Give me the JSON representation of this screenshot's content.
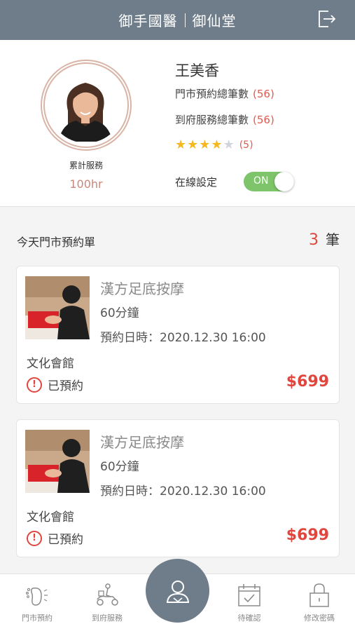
{
  "header": {
    "title_left": "御手國醫",
    "title_right": "御仙堂"
  },
  "profile": {
    "name": "王美香",
    "service_label": "累計服務",
    "service_hours": "100hr",
    "stats": [
      {
        "label": "門市預約總筆數",
        "value": "(56)"
      },
      {
        "label": "到府服務總筆數",
        "value": "(56)"
      }
    ],
    "rating": {
      "stars": 4,
      "max": 5,
      "count": "(5)"
    },
    "online_label": "在線設定",
    "online_toggle": "ON"
  },
  "section": {
    "title": "今天門市預約單",
    "count": "3",
    "count_unit": "筆"
  },
  "bookings": [
    {
      "service": "漢方足底按摩",
      "duration": "60分鐘",
      "time": "預約日時：2020.12.30 16:00",
      "venue": "文化會館",
      "status": "已預約",
      "price": "$699"
    },
    {
      "service": "漢方足底按摩",
      "duration": "60分鐘",
      "time": "預約日時：2020.12.30 16:00",
      "venue": "文化會館",
      "status": "已預約",
      "price": "$699"
    }
  ],
  "tabbar": {
    "items": [
      {
        "label": "門市預約",
        "icon": "foot-icon"
      },
      {
        "label": "到府服務",
        "icon": "scooter-icon"
      },
      {
        "label": "",
        "icon": "user-icon"
      },
      {
        "label": "待確認",
        "icon": "calendar-check-icon"
      },
      {
        "label": "修改密碼",
        "icon": "lock-icon"
      }
    ]
  },
  "colors": {
    "header": "#6f7d8b",
    "accent_red": "#e0463e",
    "toggle_green": "#7dc46a",
    "star_gold": "#f5b820"
  }
}
